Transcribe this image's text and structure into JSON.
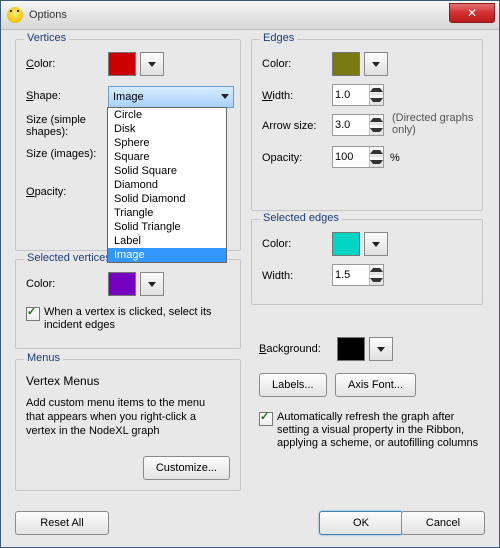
{
  "window": {
    "title": "Options"
  },
  "vertices": {
    "group_label": "Vertices",
    "color_label": "Color:",
    "color_value": "#cc0000",
    "shape_label": "Shape:",
    "shape_selected": "Image",
    "shape_options": [
      "Circle",
      "Disk",
      "Sphere",
      "Square",
      "Solid Square",
      "Diamond",
      "Solid Diamond",
      "Triangle",
      "Solid Triangle",
      "Label",
      "Image"
    ],
    "size_simple_label": "Size (simple shapes):",
    "size_images_label": "Size (images):",
    "opacity_label": "Opacity:"
  },
  "edges": {
    "group_label": "Edges",
    "color_label": "Color:",
    "color_value": "#7a7a12",
    "width_label": "Width:",
    "width_value": "1.0",
    "arrow_size_label": "Arrow size:",
    "arrow_size_value": "3.0",
    "arrow_note": "(Directed graphs only)",
    "opacity_label": "Opacity:",
    "opacity_value": "100",
    "opacity_unit": "%"
  },
  "selected_vertices": {
    "group_label": "Selected vertices",
    "color_label": "Color:",
    "color_value": "#7400c0",
    "incident_checkbox": "When a vertex is clicked, select its incident edges",
    "incident_checked": true
  },
  "selected_edges": {
    "group_label": "Selected edges",
    "color_label": "Color:",
    "color_value": "#00d4c4",
    "width_label": "Width:",
    "width_value": "1.5"
  },
  "menus": {
    "group_label": "Menus",
    "heading": "Vertex Menus",
    "desc": "Add custom menu items to the menu that appears when you right-click a vertex in the NodeXL graph",
    "customize_btn": "Customize..."
  },
  "misc": {
    "background_label": "Background:",
    "background_value": "#000000",
    "labels_btn": "Labels...",
    "axis_font_btn": "Axis Font...",
    "autorefresh_label": "Automatically refresh the graph after setting a visual property in the Ribbon, applying a scheme, or autofilling columns",
    "autorefresh_checked": true
  },
  "footer": {
    "reset_btn": "Reset All",
    "ok_btn": "OK",
    "cancel_btn": "Cancel"
  }
}
